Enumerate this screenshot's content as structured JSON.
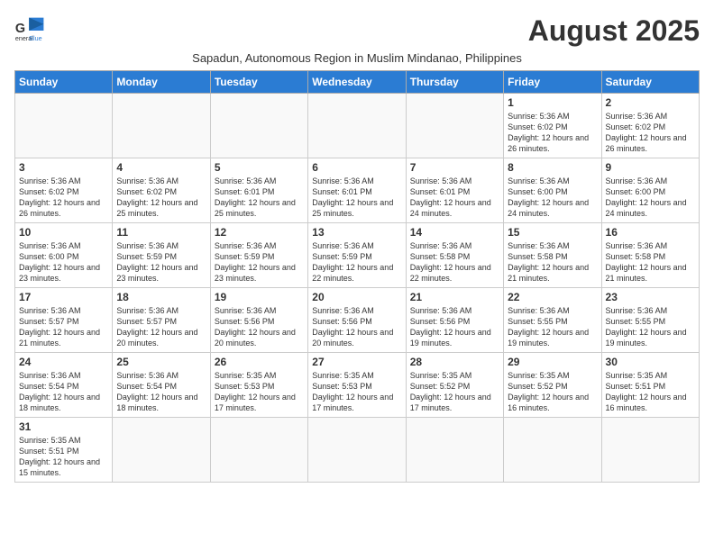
{
  "header": {
    "logo_line1": "General",
    "logo_line2": "Blue",
    "title": "August 2025",
    "subtitle": "Sapadun, Autonomous Region in Muslim Mindanao, Philippines"
  },
  "weekdays": [
    "Sunday",
    "Monday",
    "Tuesday",
    "Wednesday",
    "Thursday",
    "Friday",
    "Saturday"
  ],
  "weeks": [
    [
      {
        "day": "",
        "info": ""
      },
      {
        "day": "",
        "info": ""
      },
      {
        "day": "",
        "info": ""
      },
      {
        "day": "",
        "info": ""
      },
      {
        "day": "",
        "info": ""
      },
      {
        "day": "1",
        "info": "Sunrise: 5:36 AM\nSunset: 6:02 PM\nDaylight: 12 hours\nand 26 minutes."
      },
      {
        "day": "2",
        "info": "Sunrise: 5:36 AM\nSunset: 6:02 PM\nDaylight: 12 hours\nand 26 minutes."
      }
    ],
    [
      {
        "day": "3",
        "info": "Sunrise: 5:36 AM\nSunset: 6:02 PM\nDaylight: 12 hours\nand 26 minutes."
      },
      {
        "day": "4",
        "info": "Sunrise: 5:36 AM\nSunset: 6:02 PM\nDaylight: 12 hours\nand 25 minutes."
      },
      {
        "day": "5",
        "info": "Sunrise: 5:36 AM\nSunset: 6:01 PM\nDaylight: 12 hours\nand 25 minutes."
      },
      {
        "day": "6",
        "info": "Sunrise: 5:36 AM\nSunset: 6:01 PM\nDaylight: 12 hours\nand 25 minutes."
      },
      {
        "day": "7",
        "info": "Sunrise: 5:36 AM\nSunset: 6:01 PM\nDaylight: 12 hours\nand 24 minutes."
      },
      {
        "day": "8",
        "info": "Sunrise: 5:36 AM\nSunset: 6:00 PM\nDaylight: 12 hours\nand 24 minutes."
      },
      {
        "day": "9",
        "info": "Sunrise: 5:36 AM\nSunset: 6:00 PM\nDaylight: 12 hours\nand 24 minutes."
      }
    ],
    [
      {
        "day": "10",
        "info": "Sunrise: 5:36 AM\nSunset: 6:00 PM\nDaylight: 12 hours\nand 23 minutes."
      },
      {
        "day": "11",
        "info": "Sunrise: 5:36 AM\nSunset: 5:59 PM\nDaylight: 12 hours\nand 23 minutes."
      },
      {
        "day": "12",
        "info": "Sunrise: 5:36 AM\nSunset: 5:59 PM\nDaylight: 12 hours\nand 23 minutes."
      },
      {
        "day": "13",
        "info": "Sunrise: 5:36 AM\nSunset: 5:59 PM\nDaylight: 12 hours\nand 22 minutes."
      },
      {
        "day": "14",
        "info": "Sunrise: 5:36 AM\nSunset: 5:58 PM\nDaylight: 12 hours\nand 22 minutes."
      },
      {
        "day": "15",
        "info": "Sunrise: 5:36 AM\nSunset: 5:58 PM\nDaylight: 12 hours\nand 21 minutes."
      },
      {
        "day": "16",
        "info": "Sunrise: 5:36 AM\nSunset: 5:58 PM\nDaylight: 12 hours\nand 21 minutes."
      }
    ],
    [
      {
        "day": "17",
        "info": "Sunrise: 5:36 AM\nSunset: 5:57 PM\nDaylight: 12 hours\nand 21 minutes."
      },
      {
        "day": "18",
        "info": "Sunrise: 5:36 AM\nSunset: 5:57 PM\nDaylight: 12 hours\nand 20 minutes."
      },
      {
        "day": "19",
        "info": "Sunrise: 5:36 AM\nSunset: 5:56 PM\nDaylight: 12 hours\nand 20 minutes."
      },
      {
        "day": "20",
        "info": "Sunrise: 5:36 AM\nSunset: 5:56 PM\nDaylight: 12 hours\nand 20 minutes."
      },
      {
        "day": "21",
        "info": "Sunrise: 5:36 AM\nSunset: 5:56 PM\nDaylight: 12 hours\nand 19 minutes."
      },
      {
        "day": "22",
        "info": "Sunrise: 5:36 AM\nSunset: 5:55 PM\nDaylight: 12 hours\nand 19 minutes."
      },
      {
        "day": "23",
        "info": "Sunrise: 5:36 AM\nSunset: 5:55 PM\nDaylight: 12 hours\nand 19 minutes."
      }
    ],
    [
      {
        "day": "24",
        "info": "Sunrise: 5:36 AM\nSunset: 5:54 PM\nDaylight: 12 hours\nand 18 minutes."
      },
      {
        "day": "25",
        "info": "Sunrise: 5:36 AM\nSunset: 5:54 PM\nDaylight: 12 hours\nand 18 minutes."
      },
      {
        "day": "26",
        "info": "Sunrise: 5:35 AM\nSunset: 5:53 PM\nDaylight: 12 hours\nand 17 minutes."
      },
      {
        "day": "27",
        "info": "Sunrise: 5:35 AM\nSunset: 5:53 PM\nDaylight: 12 hours\nand 17 minutes."
      },
      {
        "day": "28",
        "info": "Sunrise: 5:35 AM\nSunset: 5:52 PM\nDaylight: 12 hours\nand 17 minutes."
      },
      {
        "day": "29",
        "info": "Sunrise: 5:35 AM\nSunset: 5:52 PM\nDaylight: 12 hours\nand 16 minutes."
      },
      {
        "day": "30",
        "info": "Sunrise: 5:35 AM\nSunset: 5:51 PM\nDaylight: 12 hours\nand 16 minutes."
      }
    ],
    [
      {
        "day": "31",
        "info": "Sunrise: 5:35 AM\nSunset: 5:51 PM\nDaylight: 12 hours\nand 15 minutes."
      },
      {
        "day": "",
        "info": ""
      },
      {
        "day": "",
        "info": ""
      },
      {
        "day": "",
        "info": ""
      },
      {
        "day": "",
        "info": ""
      },
      {
        "day": "",
        "info": ""
      },
      {
        "day": "",
        "info": ""
      }
    ]
  ]
}
